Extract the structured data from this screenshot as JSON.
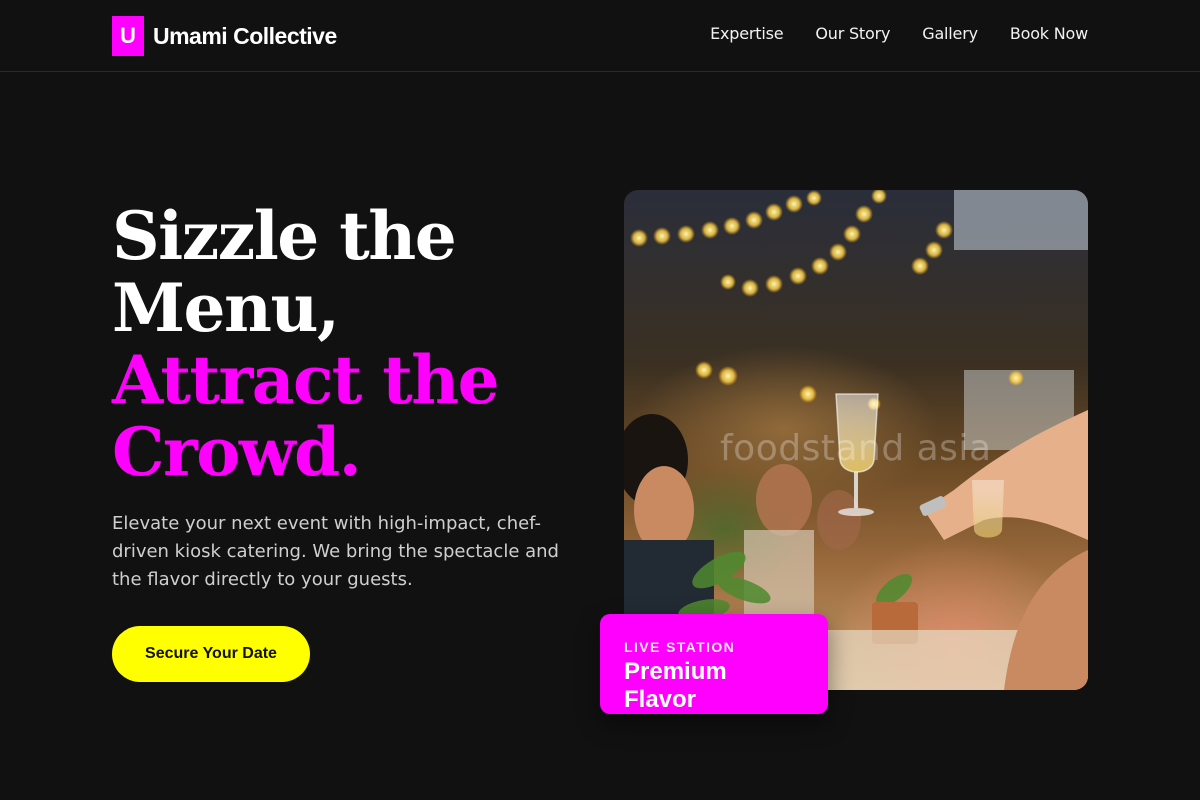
{
  "brand": {
    "mark": "U",
    "name": "Umami Collective",
    "accent": "#ff00ff",
    "cta_color": "#ffff00"
  },
  "nav": {
    "items": [
      {
        "label": "Expertise"
      },
      {
        "label": "Our Story"
      },
      {
        "label": "Gallery"
      },
      {
        "label": "Book Now"
      }
    ]
  },
  "hero": {
    "headline_line1": "Sizzle the",
    "headline_line2": "Menu,",
    "headline_line3": "Attract the",
    "headline_line4": "Crowd.",
    "subtitle": "Elevate your next event with high-impact, chef-driven kiosk catering. We bring the spectacle and the flavor directly to your guests.",
    "cta_label": "Secure Your Date"
  },
  "photo": {
    "watermark": "foodstand asia",
    "icon": "event-photo"
  },
  "badge": {
    "label": "LIVE STATION",
    "title": "Premium Flavor"
  }
}
